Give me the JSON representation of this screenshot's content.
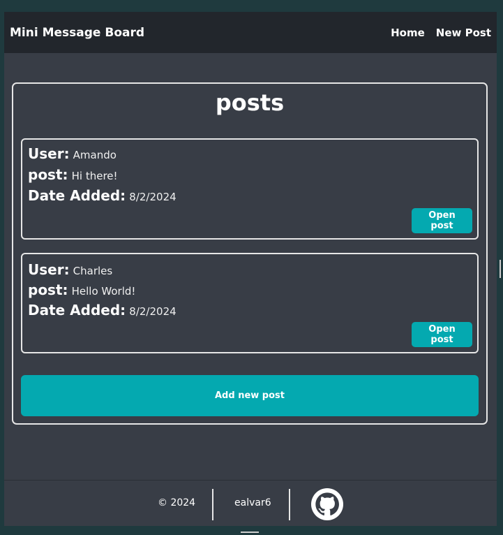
{
  "navbar": {
    "brand": "Mini Message Board",
    "links": [
      {
        "label": "Home"
      },
      {
        "label": "New Post"
      }
    ]
  },
  "posts_section": {
    "title": "posts",
    "posts": [
      {
        "user_label": "User:",
        "user": "Amando",
        "post_label": "post:",
        "post": "Hi there!",
        "date_label": "Date Added:",
        "date": "8/2/2024",
        "button": "Open post"
      },
      {
        "user_label": "User:",
        "user": "Charles",
        "post_label": "post:",
        "post": "Hello World!",
        "date_label": "Date Added:",
        "date": "8/2/2024",
        "button": "Open post"
      }
    ],
    "add_button": "Add new post"
  },
  "footer": {
    "copyright": "© 2024",
    "author": "ealvar6",
    "icon": "github-icon"
  },
  "colors": {
    "accent": "#04a9b0",
    "background": "#383d46",
    "navbar": "#22262c",
    "border": "#e6e6e6"
  }
}
